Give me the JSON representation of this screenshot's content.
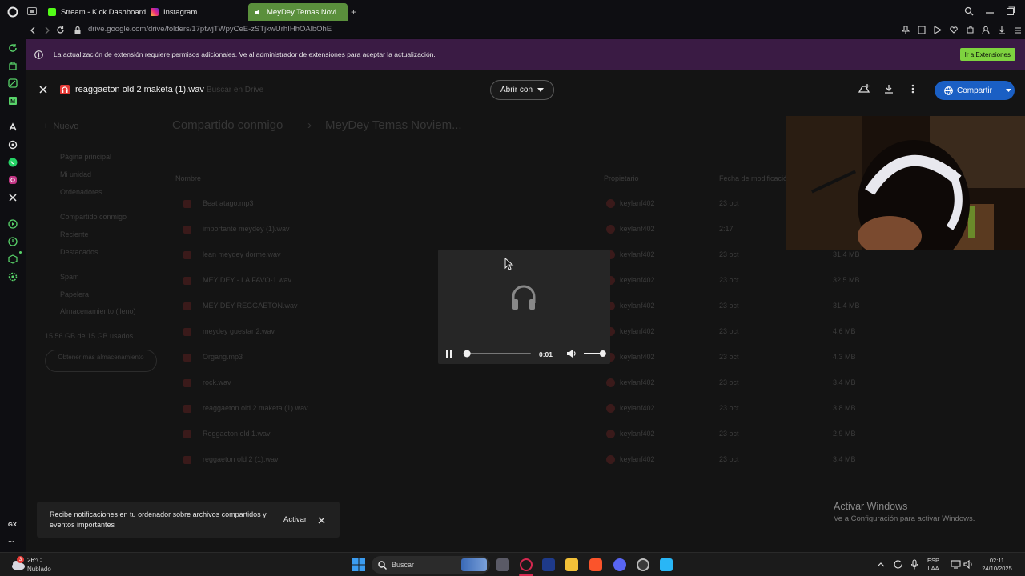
{
  "browser": {
    "tabs": [
      {
        "label": "Stream - Kick Dashboard",
        "icon": "kick-icon",
        "color": "#53fc18"
      },
      {
        "label": "Instagram",
        "icon": "instagram-icon",
        "color": "#e1306c"
      },
      {
        "label": "MeyDey Temas Novi",
        "icon": "drive-icon",
        "color": "#5a8f3c",
        "active": true
      }
    ],
    "url": "drive.google.com/drive/folders/17ptwjTWpyCeE-zSTjkwUrhIHhOAlbOhE",
    "sidebar_icons": [
      "opera-gx-icon",
      "refresh-icon",
      "bag-icon",
      "joystick-icon",
      "tv-icon",
      "arrow-icon",
      "chatgpt-icon",
      "whatsapp-icon",
      "instagram-icon",
      "x-icon",
      "play-circle-icon",
      "clock-icon",
      "cube-icon",
      "settings-icon"
    ],
    "sidebar_footer": "GX",
    "sidebar_more": "..."
  },
  "extension_banner": {
    "message": "La actualización de extensión requiere permisos adicionales. Ve al administrador de extensiones para aceptar la actualización.",
    "button": "Ir a Extensiones"
  },
  "viewer": {
    "file_name": "reaggaeton old 2 maketa (1).wav",
    "open_with": "Abrir con",
    "share": "Compartir"
  },
  "drive_background": {
    "new_button": "Nuevo",
    "search_placeholder": "Buscar en Drive",
    "breadcrumb_root": "Compartido conmigo",
    "breadcrumb_folder": "MeyDey Temas Noviem...",
    "nav": [
      "Página principal",
      "Mi unidad",
      "Ordenadores",
      "Compartido conmigo",
      "Reciente",
      "Destacados",
      "Spam",
      "Papelera",
      "Almacenamiento (lleno)"
    ],
    "storage": "15,56 GB de 15 GB usados",
    "storage_button": "Obtener más almacenamiento",
    "columns": [
      "Nombre",
      "Propietario",
      "Fecha de modificación"
    ],
    "files": [
      {
        "name": "Beat atago.mp3",
        "owner": "keylanf402",
        "date": "23 oct",
        "size": ""
      },
      {
        "name": "importante meydey (1).wav",
        "owner": "keylanf402",
        "date": "2:17",
        "size": ""
      },
      {
        "name": "lean meydey dorme.wav",
        "owner": "keylanf402",
        "date": "23 oct",
        "size": "31,4 MB"
      },
      {
        "name": "MEY DEY - LA FAVO-1.wav",
        "owner": "keylanf402",
        "date": "23 oct",
        "size": "32,5 MB"
      },
      {
        "name": "MEY DEY REGGAETON.wav",
        "owner": "keylanf402",
        "date": "23 oct",
        "size": "31,4 MB"
      },
      {
        "name": "meydey guestar 2.wav",
        "owner": "keylanf402",
        "date": "23 oct",
        "size": "4,6 MB"
      },
      {
        "name": "Organg.mp3",
        "owner": "keylanf402",
        "date": "23 oct",
        "size": "4,3 MB"
      },
      {
        "name": "rock.wav",
        "owner": "keylanf402",
        "date": "23 oct",
        "size": "3,4 MB"
      },
      {
        "name": "reaggaeton old 2 maketa (1).wav",
        "owner": "keylanf402",
        "date": "23 oct",
        "size": "3,8 MB"
      },
      {
        "name": "Reggaeton old 1.wav",
        "owner": "keylanf402",
        "date": "23 oct",
        "size": "2,9 MB"
      },
      {
        "name": "reggaeton old 2 (1).wav",
        "owner": "keylanf402",
        "date": "23 oct",
        "size": "3,4 MB"
      }
    ]
  },
  "player": {
    "time": "0:01",
    "progress": 0.05,
    "volume": 0.85
  },
  "toast": {
    "message": "Recibe notificaciones en tu ordenador sobre archivos compartidos y eventos importantes",
    "action": "Activar"
  },
  "watermark": {
    "title": "Activar Windows",
    "subtitle": "Ve a Configuración para activar Windows."
  },
  "taskbar": {
    "weather_temp": "26°C",
    "weather_desc": "Nublado",
    "weather_badge": "3",
    "search_placeholder": "Buscar",
    "language": "ESP",
    "layout": "LAA",
    "time": "02:11",
    "date": "24/10/2025"
  }
}
